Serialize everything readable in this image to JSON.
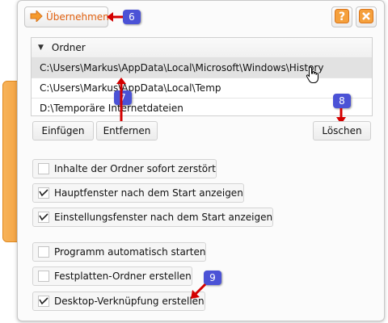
{
  "toolbar": {
    "apply_label": "Übernehmen",
    "help_icon": "question-icon",
    "close_icon": "close-icon"
  },
  "folders": {
    "header": "Ordner",
    "items": [
      "C:\\Users\\Markus\\AppData\\Local\\Microsoft\\Windows\\History",
      "C:\\Users\\Markus\\AppData\\Local\\Temp",
      "D:\\Temporäre Internetdateien"
    ],
    "selected_index": 0
  },
  "actions": {
    "add_label": "Einfügen",
    "remove_label": "Entfernen",
    "delete_label": "Löschen"
  },
  "options": [
    {
      "label": "Inhalte der Ordner sofort zerstört",
      "checked": false
    },
    {
      "label": "Hauptfenster nach dem Start anzeigen",
      "checked": true
    },
    {
      "label": "Einstellungsfenster nach dem Start anzeigen",
      "checked": true
    },
    {
      "label": "Programm automatisch starten",
      "checked": false
    },
    {
      "label": "Festplatten-Ordner erstellen",
      "checked": false
    },
    {
      "label": "Desktop-Verknüpfung erstellen",
      "checked": true
    }
  ],
  "callouts": [
    "6",
    "7",
    "8",
    "9"
  ],
  "colors": {
    "accent_orange": "#f5a03c",
    "apply_text": "#e0600f",
    "badge_blue": "#4b52d6",
    "arrow_red": "#d40000"
  }
}
